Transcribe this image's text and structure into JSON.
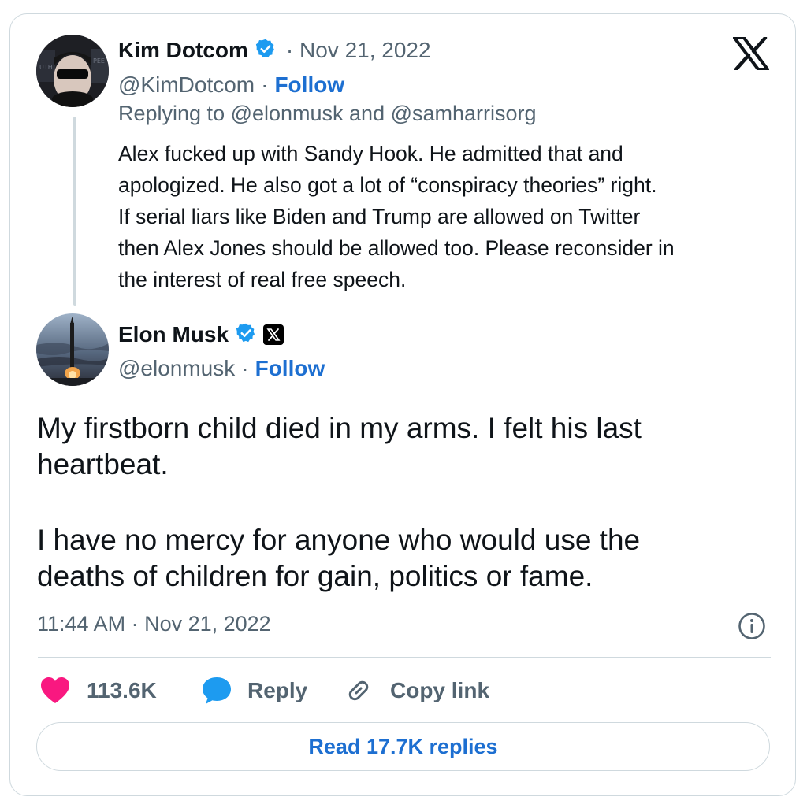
{
  "brand_logo": "x-logo-icon",
  "parent": {
    "author_name": "Kim Dotcom",
    "dot_date": "· Nov 21, 2022",
    "handle": "@KimDotcom",
    "separator": "·",
    "follow_label": "Follow",
    "replying_to": "Replying to @elonmusk and @samharrisorg",
    "text_lines": [
      "Alex fucked up with Sandy Hook. He admitted that and",
      "apologized. He also got a lot of “conspiracy theories” right.",
      "If serial liars like Biden and Trump are allowed on Twitter",
      "then Alex Jones should be allowed too. Please reconsider in",
      "the interest of real free speech."
    ]
  },
  "main": {
    "author_name": "Elon Musk",
    "handle": "@elonmusk",
    "separator": "·",
    "follow_label": "Follow",
    "text_lines_p1": [
      "My firstborn child died in my arms. I felt his last",
      "heartbeat."
    ],
    "text_lines_p2": [
      "I have no mercy for anyone who would use the",
      "deaths of children for gain, politics or fame."
    ],
    "timestamp": "11:44 AM · Nov 21, 2022"
  },
  "actions": {
    "like_count": "113.6K",
    "reply_label": "Reply",
    "copy_link_label": "Copy link"
  },
  "read_replies_label": "Read 17.7K replies",
  "colors": {
    "link_blue": "#1d6fd1",
    "verified_blue": "#1d9bf0",
    "like_pink": "#f91880",
    "text_gray": "#536471",
    "border": "#cfd9de"
  }
}
